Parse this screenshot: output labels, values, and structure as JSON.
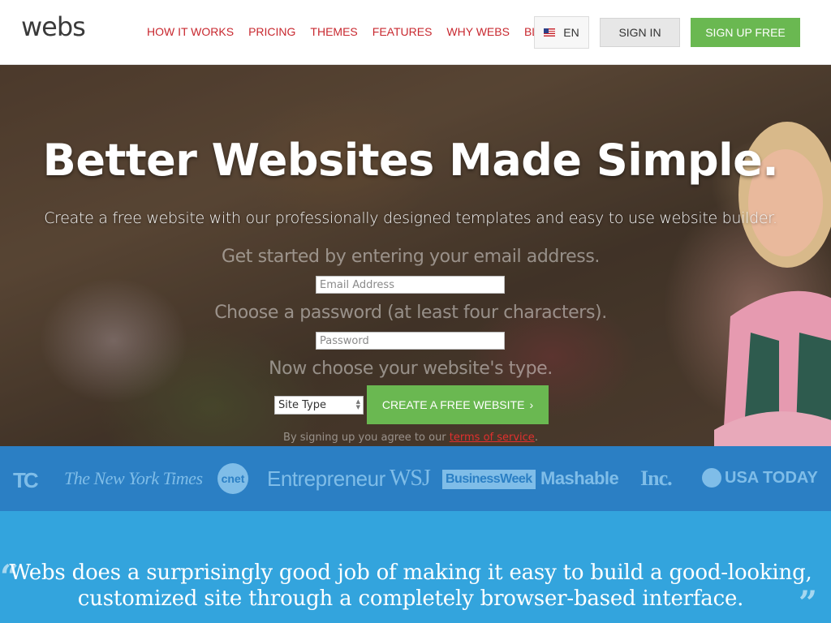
{
  "header": {
    "logo": "webs",
    "nav": [
      "HOW IT WORKS",
      "PRICING",
      "THEMES",
      "FEATURES",
      "WHY WEBS",
      "BLOG"
    ],
    "language": "EN",
    "language_flag_icon": "us-flag-icon",
    "sign_in": "SIGN IN",
    "sign_up": "SIGN UP FREE"
  },
  "hero": {
    "title": "Better Websites Made Simple.",
    "subtitle": "Create a free website with our professionally designed templates and easy to use website builder.",
    "email_prompt": "Get started by entering your email address.",
    "email_placeholder": "Email Address",
    "password_prompt": "Choose a password (at least four characters).",
    "password_placeholder": "Password",
    "type_prompt": "Now choose your website's type.",
    "site_type": "Site Type",
    "create_button": "CREATE A FREE WEBSITE",
    "create_icon": "chevron-right-icon",
    "terms_prefix": "By signing up you agree to our ",
    "terms_link": "terms of service",
    "terms_suffix": "."
  },
  "press": {
    "logos": [
      "TC",
      "The New York Times",
      "cnet",
      "Entrepreneur",
      "WSJ",
      "BusinessWeek",
      "Mashable",
      "Inc.",
      "USA TODAY"
    ]
  },
  "quote": {
    "open_mark": "“",
    "close_mark": "”",
    "line1": "Webs does a surprisingly good job of making it easy to build a good-looking,",
    "line2": "customized site through a completely browser-based interface."
  },
  "colors": {
    "accent_red": "#c8282f",
    "button_green": "#6ab851",
    "press_blue": "#2b7fc4",
    "quote_blue": "#33a4dd"
  }
}
